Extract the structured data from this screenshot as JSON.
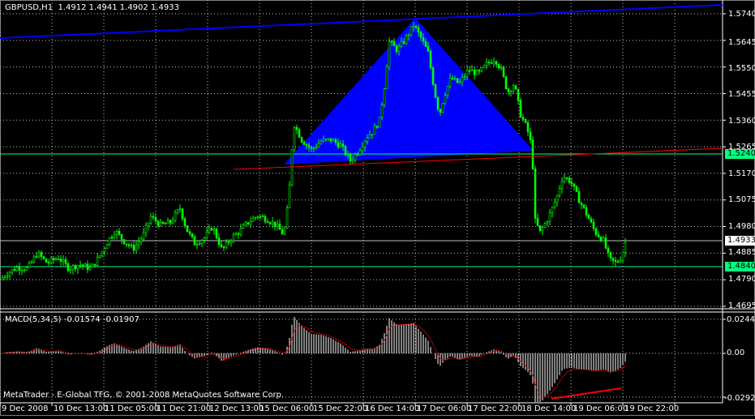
{
  "header": {
    "symbol": "GBPUSD,H1",
    "ohlc": "1.4912 1.4941 1.4902 1.4933"
  },
  "price_axis": {
    "ticks": [
      "1.5740",
      "1.5645",
      "1.5550",
      "1.5455",
      "1.5360",
      "1.5265",
      "1.5170",
      "1.5075",
      "1.4980",
      "1.4885",
      "1.4790",
      "1.4695"
    ],
    "labels": {
      "current_price": "1.4933",
      "green_line_upper": "1.5240",
      "green_line_lower": "1.4840"
    }
  },
  "time_axis": [
    "9 Dec 2008",
    "10 Dec 13:00",
    "11 Dec 05:00",
    "11 Dec 21:00",
    "12 Dec 13:00",
    "15 Dec 06:00",
    "15 Dec 22:00",
    "16 Dec 14:00",
    "17 Dec 06:00",
    "17 Dec 22:00",
    "18 Dec 14:00",
    "19 Dec 06:00",
    "19 Dec 22:00"
  ],
  "macd": {
    "label": "MACD(5,34,5) -0.01574 -0.01907",
    "ticks": [
      "0.02441",
      "0.00",
      "-0.02923"
    ]
  },
  "footer": {
    "copyright": "MetaTrader - E-Global TFG, © 2001-2008 MetaQuotes Software Corp."
  },
  "colors": {
    "bull": "#00ff00",
    "bear": "#00ff00",
    "triangle": "#0000ff",
    "trend_blue": "#0000ff",
    "trend_red": "#ff0000",
    "hline_green": "#00ff7f",
    "hline_gray": "#c0c0c0",
    "macd_hist": "#ffffff",
    "macd_signal": "#ff0000"
  },
  "chart_data": {
    "type": "candlestick",
    "y_range": [
      1.4695,
      1.576
    ],
    "close_path": [
      {
        "t": 0,
        "p": 1.479
      },
      {
        "t": 10,
        "p": 1.4815
      },
      {
        "t": 22,
        "p": 1.4835
      },
      {
        "t": 34,
        "p": 1.483
      },
      {
        "t": 46,
        "p": 1.4885
      },
      {
        "t": 58,
        "p": 1.485
      },
      {
        "t": 72,
        "p": 1.487
      },
      {
        "t": 85,
        "p": 1.483
      },
      {
        "t": 98,
        "p": 1.4845
      },
      {
        "t": 112,
        "p": 1.483
      },
      {
        "t": 124,
        "p": 1.488
      },
      {
        "t": 134,
        "p": 1.4935
      },
      {
        "t": 142,
        "p": 1.4965
      },
      {
        "t": 152,
        "p": 1.493
      },
      {
        "t": 164,
        "p": 1.49
      },
      {
        "t": 176,
        "p": 1.4945
      },
      {
        "t": 186,
        "p": 1.5015
      },
      {
        "t": 198,
        "p": 1.4985
      },
      {
        "t": 210,
        "p": 1.4995
      },
      {
        "t": 222,
        "p": 1.5045
      },
      {
        "t": 230,
        "p": 1.497
      },
      {
        "t": 240,
        "p": 1.492
      },
      {
        "t": 252,
        "p": 1.494
      },
      {
        "t": 262,
        "p": 1.498
      },
      {
        "t": 274,
        "p": 1.4895
      },
      {
        "t": 284,
        "p": 1.4935
      },
      {
        "t": 296,
        "p": 1.4965
      },
      {
        "t": 306,
        "p": 1.4995
      },
      {
        "t": 318,
        "p": 1.502
      },
      {
        "t": 330,
        "p": 1.5005
      },
      {
        "t": 340,
        "p": 1.4985
      },
      {
        "t": 350,
        "p": 1.495
      },
      {
        "t": 356,
        "p": 1.508
      },
      {
        "t": 362,
        "p": 1.535
      },
      {
        "t": 372,
        "p": 1.529
      },
      {
        "t": 384,
        "p": 1.5255
      },
      {
        "t": 396,
        "p": 1.5285
      },
      {
        "t": 408,
        "p": 1.529
      },
      {
        "t": 420,
        "p": 1.527
      },
      {
        "t": 432,
        "p": 1.5215
      },
      {
        "t": 442,
        "p": 1.525
      },
      {
        "t": 452,
        "p": 1.53
      },
      {
        "t": 460,
        "p": 1.532
      },
      {
        "t": 468,
        "p": 1.536
      },
      {
        "t": 474,
        "p": 1.548
      },
      {
        "t": 480,
        "p": 1.564
      },
      {
        "t": 490,
        "p": 1.561
      },
      {
        "t": 500,
        "p": 1.565
      },
      {
        "t": 510,
        "p": 1.57
      },
      {
        "t": 518,
        "p": 1.566
      },
      {
        "t": 528,
        "p": 1.56
      },
      {
        "t": 536,
        "p": 1.546
      },
      {
        "t": 542,
        "p": 1.538
      },
      {
        "t": 548,
        "p": 1.545
      },
      {
        "t": 556,
        "p": 1.551
      },
      {
        "t": 566,
        "p": 1.549
      },
      {
        "t": 578,
        "p": 1.554
      },
      {
        "t": 590,
        "p": 1.5525
      },
      {
        "t": 600,
        "p": 1.556
      },
      {
        "t": 610,
        "p": 1.558
      },
      {
        "t": 618,
        "p": 1.554
      },
      {
        "t": 626,
        "p": 1.546
      },
      {
        "t": 634,
        "p": 1.549
      },
      {
        "t": 642,
        "p": 1.538
      },
      {
        "t": 650,
        "p": 1.533
      },
      {
        "t": 656,
        "p": 1.526
      },
      {
        "t": 660,
        "p": 1.5
      },
      {
        "t": 666,
        "p": 1.496
      },
      {
        "t": 676,
        "p": 1.501
      },
      {
        "t": 686,
        "p": 1.508
      },
      {
        "t": 694,
        "p": 1.516
      },
      {
        "t": 704,
        "p": 1.514
      },
      {
        "t": 714,
        "p": 1.5075
      },
      {
        "t": 724,
        "p": 1.502
      },
      {
        "t": 734,
        "p": 1.496
      },
      {
        "t": 744,
        "p": 1.493
      },
      {
        "t": 752,
        "p": 1.486
      },
      {
        "t": 760,
        "p": 1.485
      },
      {
        "t": 766,
        "p": 1.487
      },
      {
        "t": 772,
        "p": 1.4933
      }
    ]
  }
}
